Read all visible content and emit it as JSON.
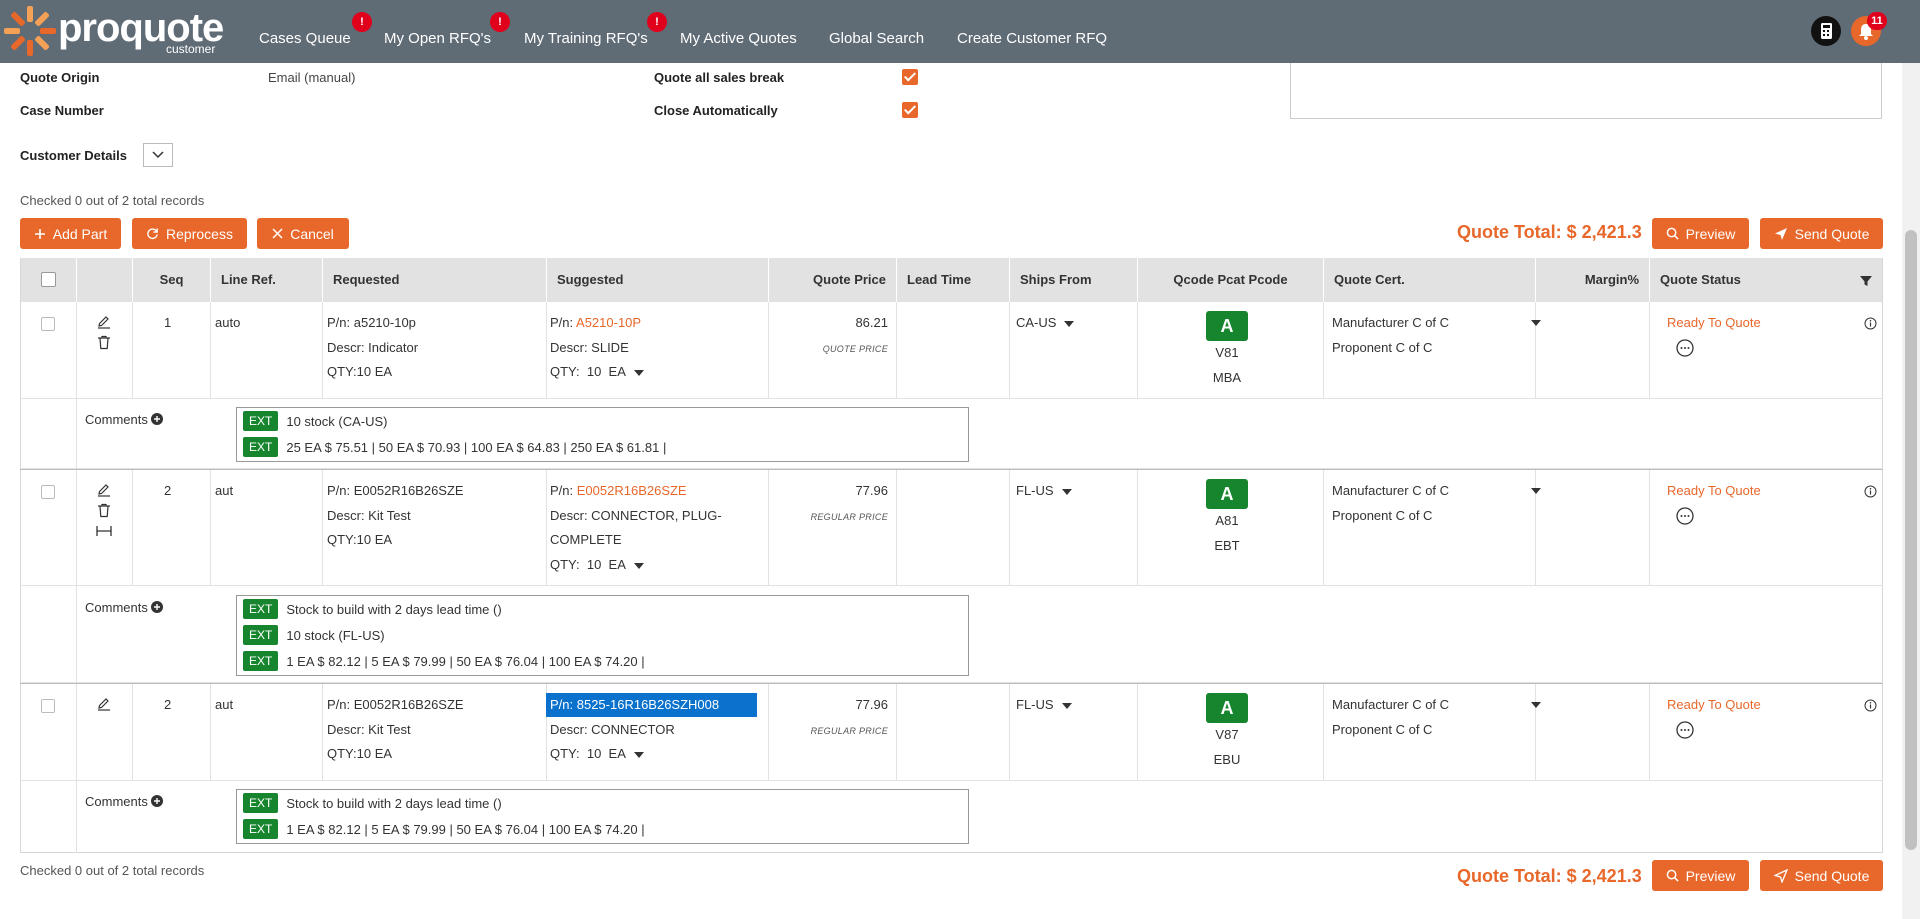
{
  "app": {
    "logo_word": "proquote",
    "logo_sub": "customer"
  },
  "nav": {
    "items": [
      {
        "label": "Cases Queue",
        "badge": "!"
      },
      {
        "label": "My Open RFQ's",
        "badge": "!"
      },
      {
        "label": "My Training RFQ's",
        "badge": "!"
      },
      {
        "label": "My Active Quotes"
      },
      {
        "label": "Global Search"
      },
      {
        "label": "Create Customer RFQ"
      }
    ],
    "notifications_count": "11"
  },
  "form": {
    "quote_origin_label": "Quote Origin",
    "quote_origin_value": "Email (manual)",
    "case_number_label": "Case Number",
    "quote_all_label": "Quote all sales break",
    "close_auto_label": "Close Automatically",
    "quote_all_checked": true,
    "close_auto_checked": true,
    "customer_details_label": "Customer Details"
  },
  "records": {
    "top_text": "Checked 0 out of 2 total records",
    "bottom_text": "Checked 0 out of 2 total records"
  },
  "toolbar": {
    "add_part": "Add Part",
    "reprocess": "Reprocess",
    "cancel": "Cancel",
    "quote_total": "Quote Total: $ 2,421.3",
    "preview": "Preview",
    "send_quote": "Send Quote"
  },
  "table": {
    "headers": {
      "seq": "Seq",
      "line_ref": "Line Ref.",
      "requested": "Requested",
      "suggested": "Suggested",
      "quote_price": "Quote Price",
      "lead_time": "Lead Time",
      "ships_from": "Ships From",
      "qcode": "Qcode Pcat Pcode",
      "quote_cert": "Quote Cert.",
      "margin": "Margin%",
      "quote_status": "Quote Status"
    },
    "rows": [
      {
        "seq": "1",
        "line_ref": "auto",
        "req_pn": "P/n: a5210-10p",
        "req_descr": "Descr: Indicator",
        "req_qty": "QTY:10 EA",
        "sug_pn_prefix": "P/n:",
        "sug_pn": "A5210-10P",
        "sug_descr": "Descr: SLIDE",
        "sug_descr2": "",
        "sug_qty": "QTY:  10  EA",
        "price": "86.21",
        "price_type": "QUOTE PRICE",
        "ships_from": "CA-US",
        "qcode": "A",
        "pcat": "V81",
        "pcode": "MBA",
        "cert1": "Manufacturer C of C",
        "cert2": "Proponent C of C",
        "status": "Ready To Quote",
        "comments_label": "Comments",
        "comments": [
          {
            "tag": "EXT",
            "text": "10 stock (CA-US)"
          },
          {
            "tag": "EXT",
            "text": "25 EA $ 75.51 | 50 EA $ 70.93 | 100 EA $ 64.83 | 250 EA $ 61.81 |"
          }
        ]
      },
      {
        "seq": "2",
        "line_ref": "aut",
        "req_pn": "P/n: E0052R16B26SZE",
        "req_descr": "Descr: Kit Test",
        "req_qty": "QTY:10 EA",
        "sug_pn_prefix": "P/n:",
        "sug_pn": "E0052R16B26SZE",
        "sug_descr": "Descr: CONNECTOR, PLUG-",
        "sug_descr2": "COMPLETE",
        "sug_qty": "QTY:  10  EA",
        "price": "77.96",
        "price_type": "REGULAR PRICE",
        "ships_from": "FL-US",
        "qcode": "A",
        "pcat": "A81",
        "pcode": "EBT",
        "cert1": "Manufacturer C of C",
        "cert2": "Proponent C of C",
        "status": "Ready To Quote",
        "comments_label": "Comments",
        "comments": [
          {
            "tag": "EXT",
            "text": "Stock to build with 2 days lead time ()"
          },
          {
            "tag": "EXT",
            "text": "10 stock (FL-US)"
          },
          {
            "tag": "EXT",
            "text": "1 EA $ 82.12 | 5 EA $ 79.99 | 50 EA $ 76.04 | 100 EA $ 74.20 |"
          }
        ]
      },
      {
        "seq": "2",
        "line_ref": "aut",
        "req_pn": "P/n: E0052R16B26SZE",
        "req_descr": "Descr: Kit Test",
        "req_qty": "QTY:10 EA",
        "sug_pn_full": "P/n: 8525-16R16B26SZH008",
        "sug_descr": "Descr: CONNECTOR",
        "sug_qty": "QTY:  10  EA",
        "price": "77.96",
        "price_type": "REGULAR PRICE",
        "ships_from": "FL-US",
        "qcode": "A",
        "pcat": "V87",
        "pcode": "EBU",
        "cert1": "Manufacturer C of C",
        "cert2": "Proponent C of C",
        "status": "Ready To Quote",
        "comments_label": "Comments",
        "comments": [
          {
            "tag": "EXT",
            "text": "Stock to build with 2 days lead time ()"
          },
          {
            "tag": "EXT",
            "text": "1 EA $ 82.12 | 5 EA $ 79.99 | 50 EA $ 76.04 | 100 EA $ 74.20 |"
          }
        ]
      }
    ]
  },
  "colors": {
    "accent": "#e8672a",
    "nav_bg": "#5f6b75",
    "qcode_green": "#17852d",
    "badge_red": "#e0001b",
    "highlight_blue": "#0a72cc"
  }
}
